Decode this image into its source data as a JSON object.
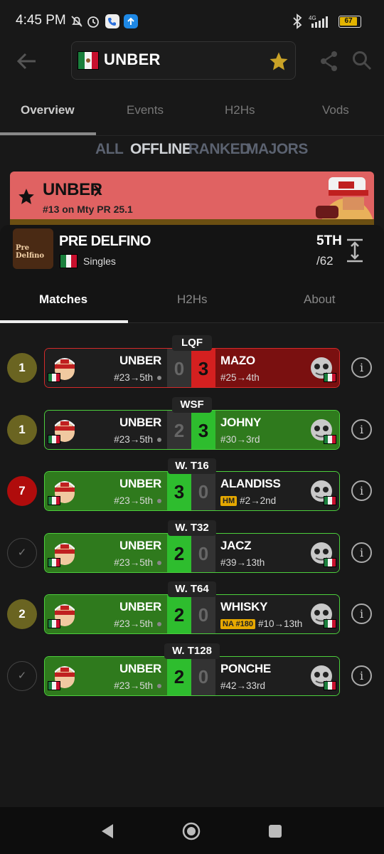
{
  "status_bar": {
    "time": "4:45 PM",
    "battery": "67",
    "network": "4G"
  },
  "header": {
    "search_value": "UNBER"
  },
  "tabs": [
    {
      "label": "Overview",
      "active": true
    },
    {
      "label": "Events"
    },
    {
      "label": "H2Hs"
    },
    {
      "label": "Vods"
    }
  ],
  "filters": [
    {
      "label": "ALL"
    },
    {
      "label": "OFFLINE",
      "active": true
    },
    {
      "label": "RANKED"
    },
    {
      "label": "MAJORS"
    }
  ],
  "banner": {
    "name": "UNBER",
    "rank": "#13 on Mty PR 25.1",
    "color": "#e06262"
  },
  "tournament": {
    "logo_text": "Pre Delfino",
    "name": "PRE DELFINO",
    "format": "Singles",
    "placement": "5TH",
    "entrants": "/62"
  },
  "subtabs": [
    {
      "label": "Matches",
      "active": true
    },
    {
      "label": "H2Hs"
    },
    {
      "label": "About"
    }
  ],
  "colors": {
    "win": "#2f7a1d",
    "loss": "#7a1010",
    "win_score": "#2ebd2e",
    "loss_score": "#d42020",
    "neutral_score": "#333333"
  },
  "matches": [
    {
      "round": "LQF",
      "circle": "1",
      "circle_type": "olive",
      "left_name": "UNBER",
      "left_seed": "#23→5th",
      "left_score": "0",
      "right_name": "MAZO",
      "right_seed": "#25→4th",
      "right_score": "3",
      "result": "loss",
      "right_badge": ""
    },
    {
      "round": "WSF",
      "circle": "1",
      "circle_type": "olive",
      "left_name": "UNBER",
      "left_seed": "#23→5th",
      "left_score": "2",
      "right_name": "JOHNY",
      "right_seed": "#30→3rd",
      "right_score": "3",
      "result": "loss-green",
      "right_badge": ""
    },
    {
      "round": "W. T16",
      "circle": "7",
      "circle_type": "red",
      "left_name": "UNBER",
      "left_seed": "#23→5th",
      "left_score": "3",
      "right_name": "ALANDISS",
      "right_seed": "#2→2nd",
      "right_score": "0",
      "result": "win",
      "right_badge": "HM"
    },
    {
      "round": "W. T32",
      "circle": "✓",
      "circle_type": "check",
      "left_name": "UNBER",
      "left_seed": "#23→5th",
      "left_score": "2",
      "right_name": "JACZ",
      "right_seed": "#39→13th",
      "right_score": "0",
      "result": "win",
      "right_badge": ""
    },
    {
      "round": "W. T64",
      "circle": "2",
      "circle_type": "olive",
      "left_name": "UNBER",
      "left_seed": "#23→5th",
      "left_score": "2",
      "right_name": "WHISKY",
      "right_seed": "#10→13th",
      "right_score": "0",
      "result": "win",
      "right_badge": "NA #180"
    },
    {
      "round": "W. T128",
      "circle": "✓",
      "circle_type": "check",
      "left_name": "UNBER",
      "left_seed": "#23→5th",
      "left_score": "2",
      "right_name": "PONCHE",
      "right_seed": "#42→33rd",
      "right_score": "0",
      "result": "win",
      "right_badge": ""
    }
  ]
}
